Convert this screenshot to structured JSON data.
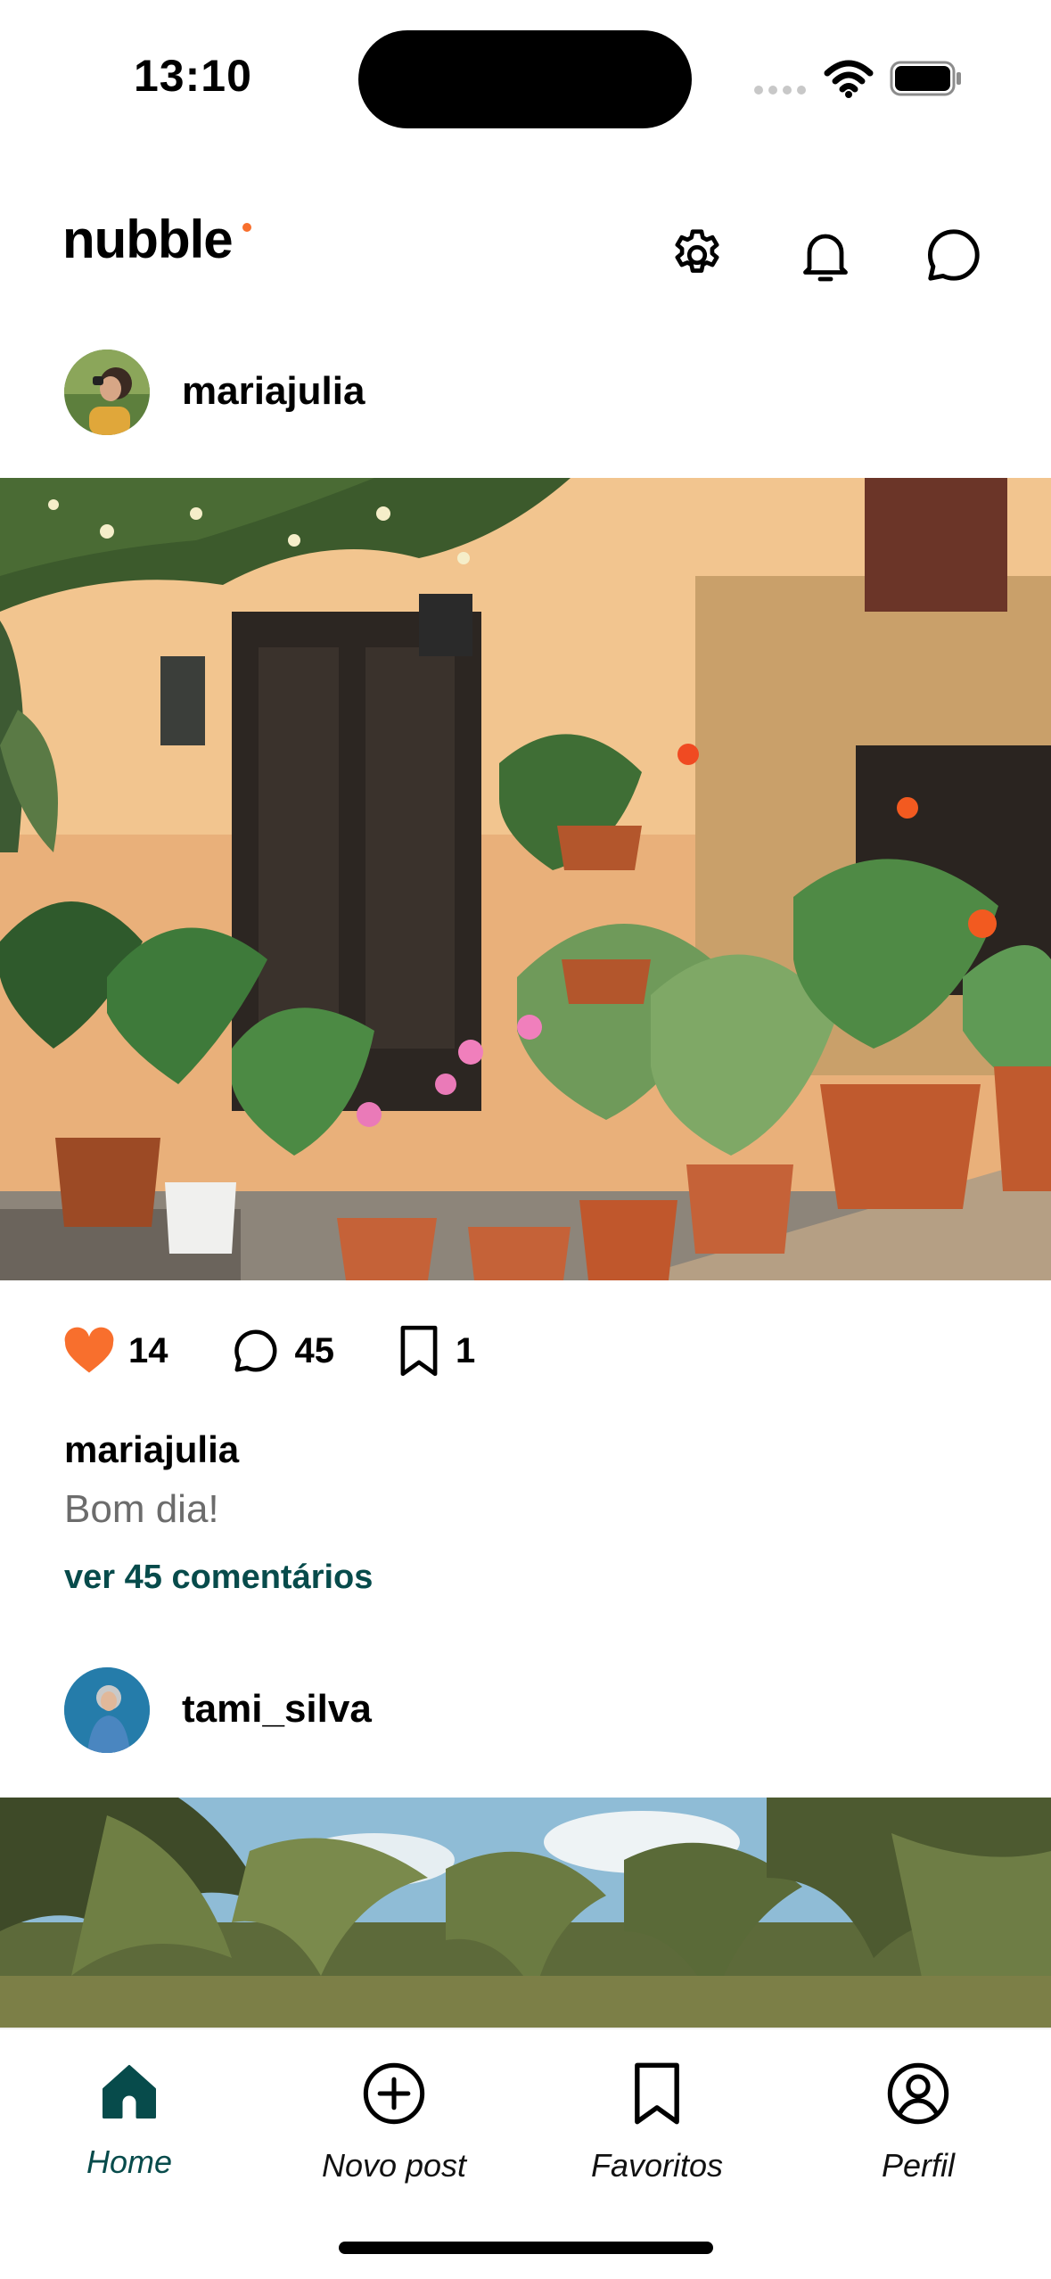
{
  "status_bar": {
    "time": "13:10"
  },
  "app": {
    "logo_text": "nubble",
    "accent_color": "#F86F2D",
    "primary_color": "#074B4B"
  },
  "header_icons": [
    "settings-icon",
    "bell-icon",
    "chat-icon"
  ],
  "posts": [
    {
      "username": "mariajulia",
      "likes": "14",
      "comments": "45",
      "favorites": "1",
      "caption_user": "mariajulia",
      "caption_text": "Bom dia!",
      "comments_link": "ver 45 comentários"
    },
    {
      "username": "tami_silva"
    }
  ],
  "bottom_nav": {
    "items": [
      {
        "label": "Home",
        "icon": "home-icon",
        "active": true
      },
      {
        "label": "Novo post",
        "icon": "plus-circle-icon",
        "active": false
      },
      {
        "label": "Favoritos",
        "icon": "bookmark-icon",
        "active": false
      },
      {
        "label": "Perfil",
        "icon": "profile-icon",
        "active": false
      }
    ]
  }
}
